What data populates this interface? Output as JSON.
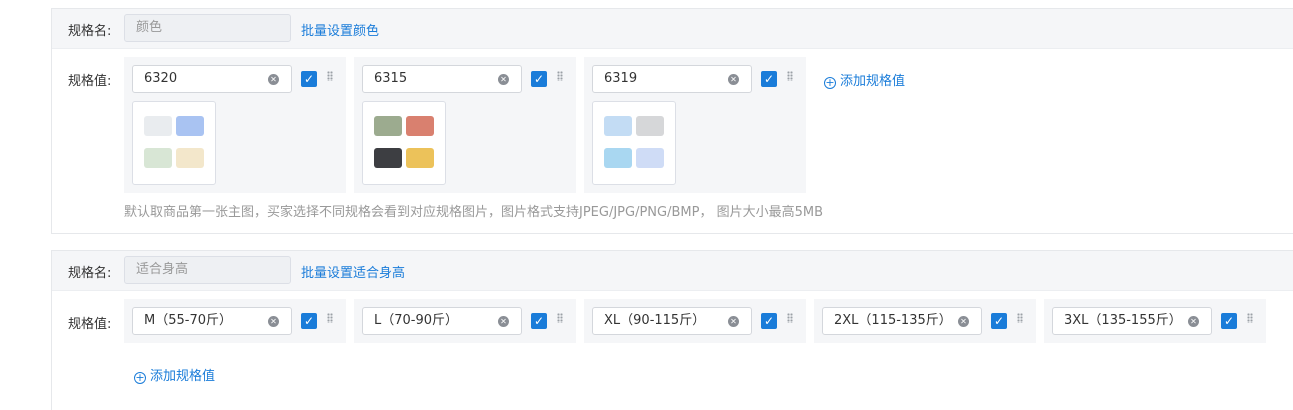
{
  "colors": {
    "accent": "#1a7cd9",
    "panel": "#f5f6f8"
  },
  "spec1": {
    "name_label": "规格名:",
    "name_value": "颜色",
    "batch_label": "批量设置颜色",
    "value_label": "规格值:",
    "values": [
      "6320",
      "6315",
      "6319"
    ],
    "add_label": "添加规格值",
    "hint": "默认取商品第一张主图，买家选择不同规格会看到对应规格图片，图片格式支持JPEG/JPG/PNG/BMP， 图片大小最高5MB"
  },
  "spec2": {
    "name_label": "规格名:",
    "name_value": "适合身高",
    "batch_label": "批量设置适合身高",
    "value_label": "规格值:",
    "values": [
      "M（55-70斤）",
      "L（70-90斤）",
      "XL（90-115斤）",
      "2XL（115-135斤）",
      "3XL（135-155斤）"
    ],
    "add_label": "添加规格值"
  }
}
